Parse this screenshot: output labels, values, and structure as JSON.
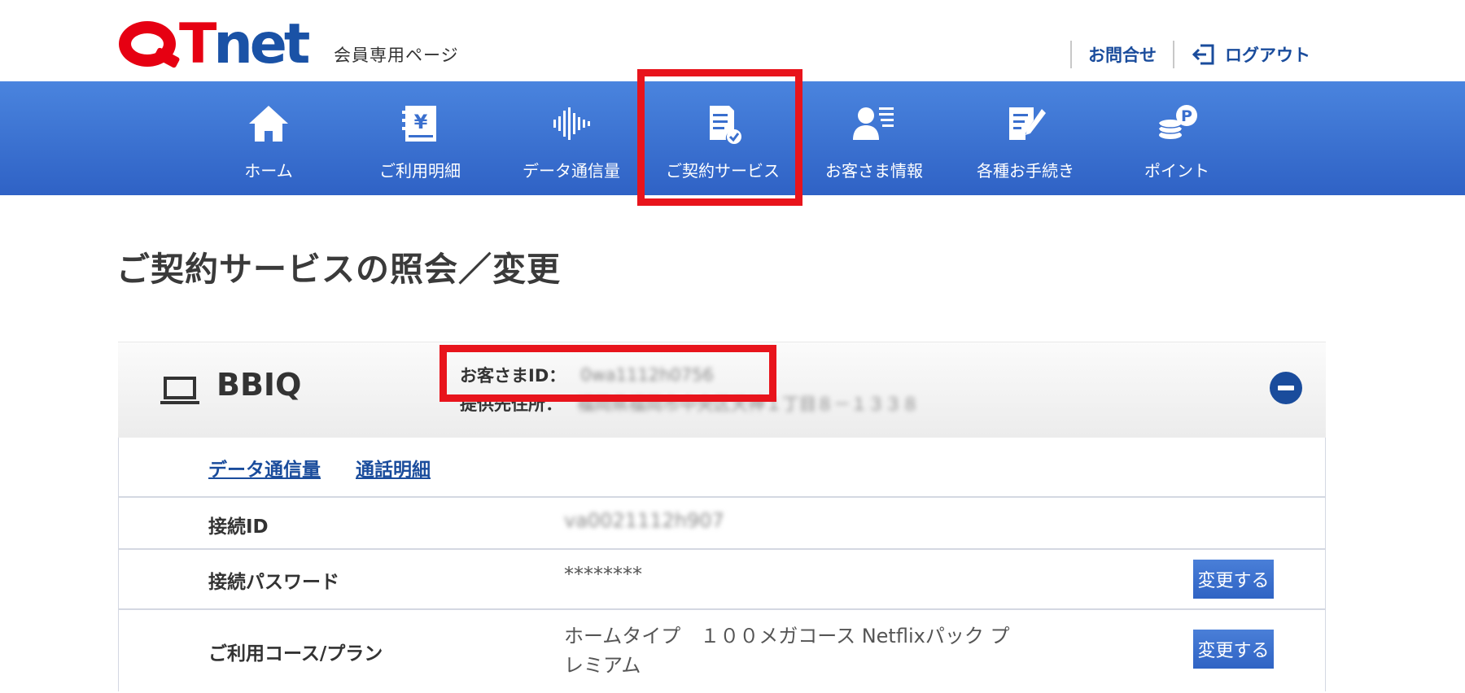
{
  "header": {
    "logo": {
      "q": "Q",
      "t": "T",
      "net": "net"
    },
    "member_label": "会員専用ページ",
    "contact_label": "お問合せ",
    "logout_label": "ログアウト"
  },
  "nav": {
    "items": [
      {
        "label": "ホーム",
        "icon": "home-icon"
      },
      {
        "label": "ご利用明細",
        "icon": "billing-icon"
      },
      {
        "label": "データ通信量",
        "icon": "data-usage-icon"
      },
      {
        "label": "ご契約サービス",
        "icon": "contract-service-icon"
      },
      {
        "label": "お客さま情報",
        "icon": "customer-info-icon"
      },
      {
        "label": "各種お手続き",
        "icon": "procedures-icon"
      },
      {
        "label": "ポイント",
        "icon": "points-icon"
      }
    ],
    "active_index": 3
  },
  "main": {
    "page_title": "ご契約サービスの照会／変更",
    "service": {
      "name": "BBIQ",
      "customer_id_label": "お客さまID：",
      "customer_id_value": "0wa1112h0756",
      "address_label": "提供先住所：",
      "address_value": "福岡県福岡市中央区天神１丁目８－１３３８"
    },
    "links": [
      "データ通信量",
      "通話明細"
    ],
    "rows": [
      {
        "label": "接続ID",
        "value": "va0021112h907"
      },
      {
        "label": "接続パスワード",
        "value": "********",
        "button": "変更する"
      },
      {
        "label": "ご利用コース/プラン",
        "value_line1": "ホームタイプ　１００メガコース Netflixパック プ",
        "value_line2": "レミアム",
        "button": "変更する"
      }
    ]
  },
  "colors": {
    "brand_red": "#e60012",
    "brand_blue": "#1a52a6",
    "nav_blue": "#3a70d0",
    "highlight_red": "#e8141c"
  }
}
